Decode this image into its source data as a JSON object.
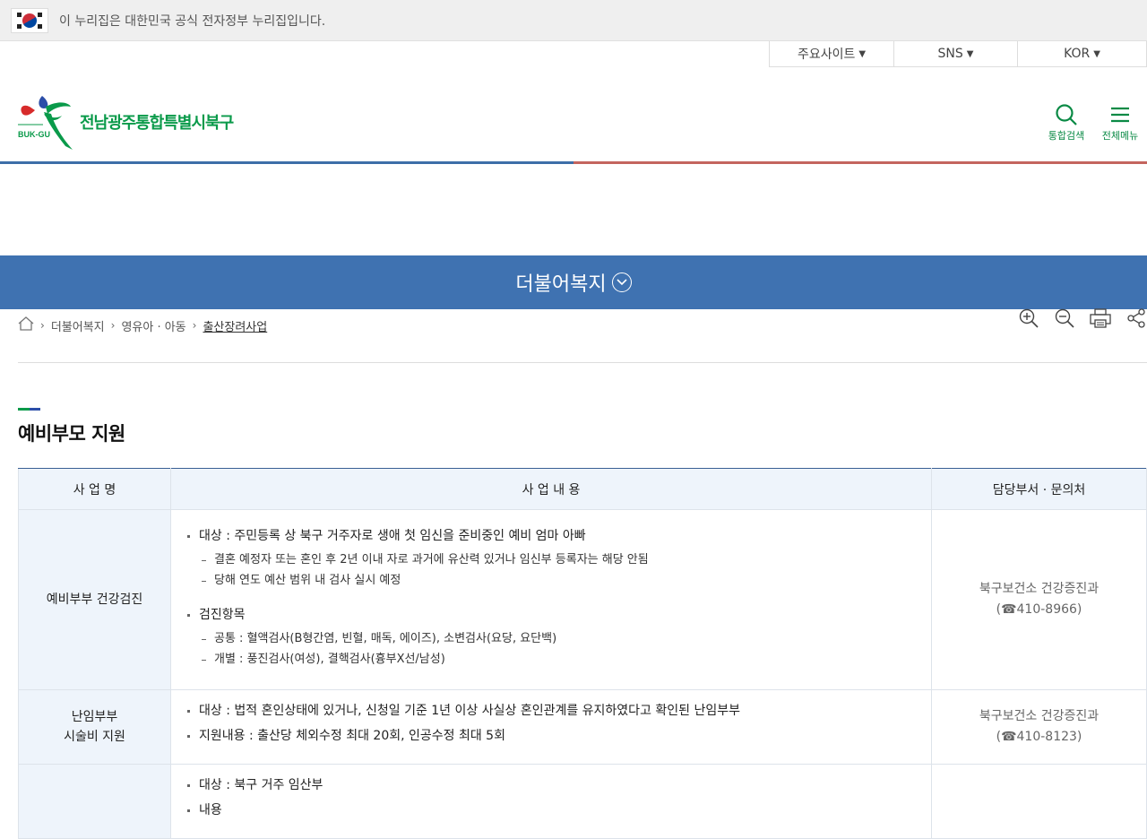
{
  "gov_banner": {
    "text": "이 누리집은 대한민국 공식 전자정부 누리집입니다."
  },
  "util": {
    "items": [
      {
        "label": "주요사이트"
      },
      {
        "label": "SNS"
      },
      {
        "label": "KOR"
      }
    ]
  },
  "header": {
    "logo_small": "BUK-GU",
    "logo_name": "전남광주통합특별시북구",
    "search_label": "통합검색",
    "menu_label": "전체메뉴"
  },
  "section": {
    "title": "더불어복지"
  },
  "breadcrumb": {
    "items": [
      "더불어복지",
      "영유아 · 아동",
      "출산장려사업"
    ]
  },
  "page": {
    "title": "예비부모 지원"
  },
  "table": {
    "headers": [
      "사 업 명",
      "사 업 내 용",
      "담당부서 · 문의처"
    ],
    "rows": [
      {
        "name": "예비부부 건강검진",
        "lines": [
          "대상 : 주민등록 상 북구 거주자로 생애 첫 임신을 준비중인 예비 엄마 아빠",
          "결혼 예정자 또는 혼인 후 2년 이내 자로 과거에 유산력 있거나 임신부 등록자는 해당 안됨",
          "당해 연도 예산 범위 내 검사 실시 예정",
          "검진항목",
          "공통 : 혈액검사(B형간염, 빈혈, 매독, 에이즈), 소변검사(요당, 요단백)",
          "개별 : 풍진검사(여성), 결핵검사(흉부X선/남성)"
        ],
        "dept": "북구보건소 건강증진과",
        "phone": "(☎410-8966)"
      },
      {
        "name_line1": "난임부부",
        "name_line2": "시술비 지원",
        "lines": [
          "대상 : 법적 혼인상태에 있거나, 신청일 기준 1년 이상 사실상 혼인관계를 유지하였다고 확인된 난임부부",
          "지원내용 : 출산당 체외수정 최대 20회, 인공수정 최대 5회"
        ],
        "dept": "북구보건소 건강증진과",
        "phone": "(☎410-8123)"
      },
      {
        "lines": [
          "대상 : 북구 거주 임산부",
          "내용"
        ]
      }
    ]
  },
  "colors": {
    "section_blue": "#3f72b1",
    "brand_green": "#0a9a4a",
    "line_red": "#c4655e"
  }
}
